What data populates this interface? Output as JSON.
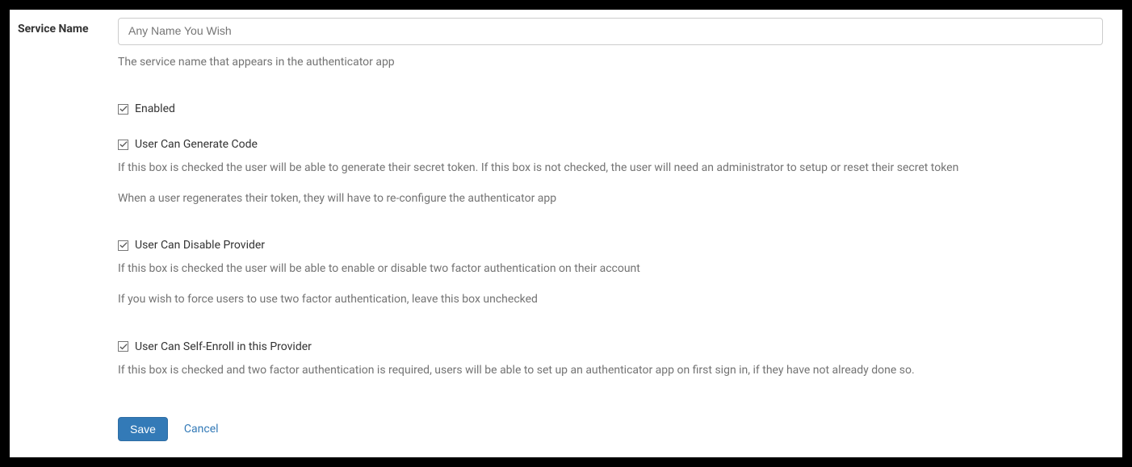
{
  "field": {
    "serviceName": {
      "label": "Service Name",
      "placeholder": "Any Name You Wish",
      "help": "The service name that appears in the authenticator app"
    }
  },
  "options": {
    "enabled": {
      "label": "Enabled"
    },
    "userCanGenerate": {
      "label": "User Can Generate Code",
      "help1": "If this box is checked the user will be able to generate their secret token. If this box is not checked, the user will need an administrator to setup or reset their secret token",
      "help2": "When a user regenerates their token, they will have to re-configure the authenticator app"
    },
    "userCanDisable": {
      "label": "User Can Disable Provider",
      "help1": "If this box is checked the user will be able to enable or disable two factor authentication on their account",
      "help2": "If you wish to force users to use two factor authentication, leave this box unchecked"
    },
    "userCanSelfEnroll": {
      "label": "User Can Self-Enroll in this Provider",
      "help1": "If this box is checked and two factor authentication is required, users will be able to set up an authenticator app on first sign in, if they have not already done so."
    }
  },
  "buttons": {
    "save": "Save",
    "cancel": "Cancel"
  }
}
